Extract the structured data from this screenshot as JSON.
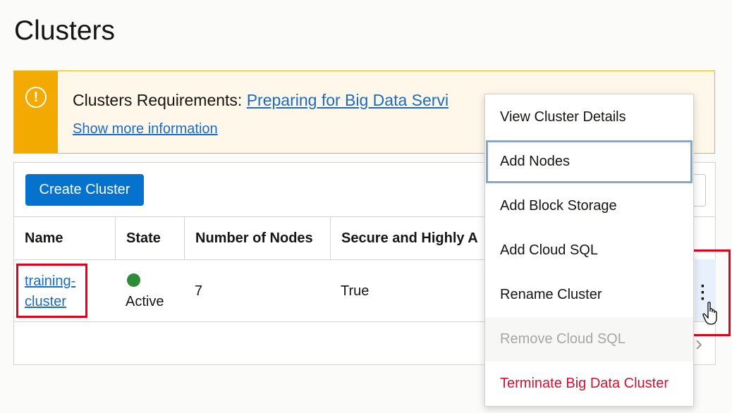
{
  "page": {
    "title": "Clusters"
  },
  "alert": {
    "prefix": "Clusters Requirements: ",
    "link_text": "Preparing for Big Data Servi",
    "more_link": "Show more information",
    "icon": "exclamation-icon",
    "accent_color": "#f2a900"
  },
  "toolbar": {
    "create_label": "Create Cluster"
  },
  "table": {
    "headers": [
      "Name",
      "State",
      "Number of Nodes",
      "Secure and Highly A"
    ],
    "rows": [
      {
        "name_line1": "training-",
        "name_line2": "cluster",
        "state": "Active",
        "nodes": "7",
        "secure_ha": "True"
      }
    ]
  },
  "menu": {
    "items": [
      "View Cluster Details",
      "Add Nodes",
      "Add Block Storage",
      "Add Cloud SQL",
      "Rename Cluster",
      "Remove Cloud SQL",
      "Terminate Big Data Cluster"
    ]
  },
  "colors": {
    "primary": "#0572ce",
    "link": "#1a6bc4",
    "active": "#2e8b3a",
    "danger": "#d3102f",
    "highlight": "#e3001b"
  }
}
